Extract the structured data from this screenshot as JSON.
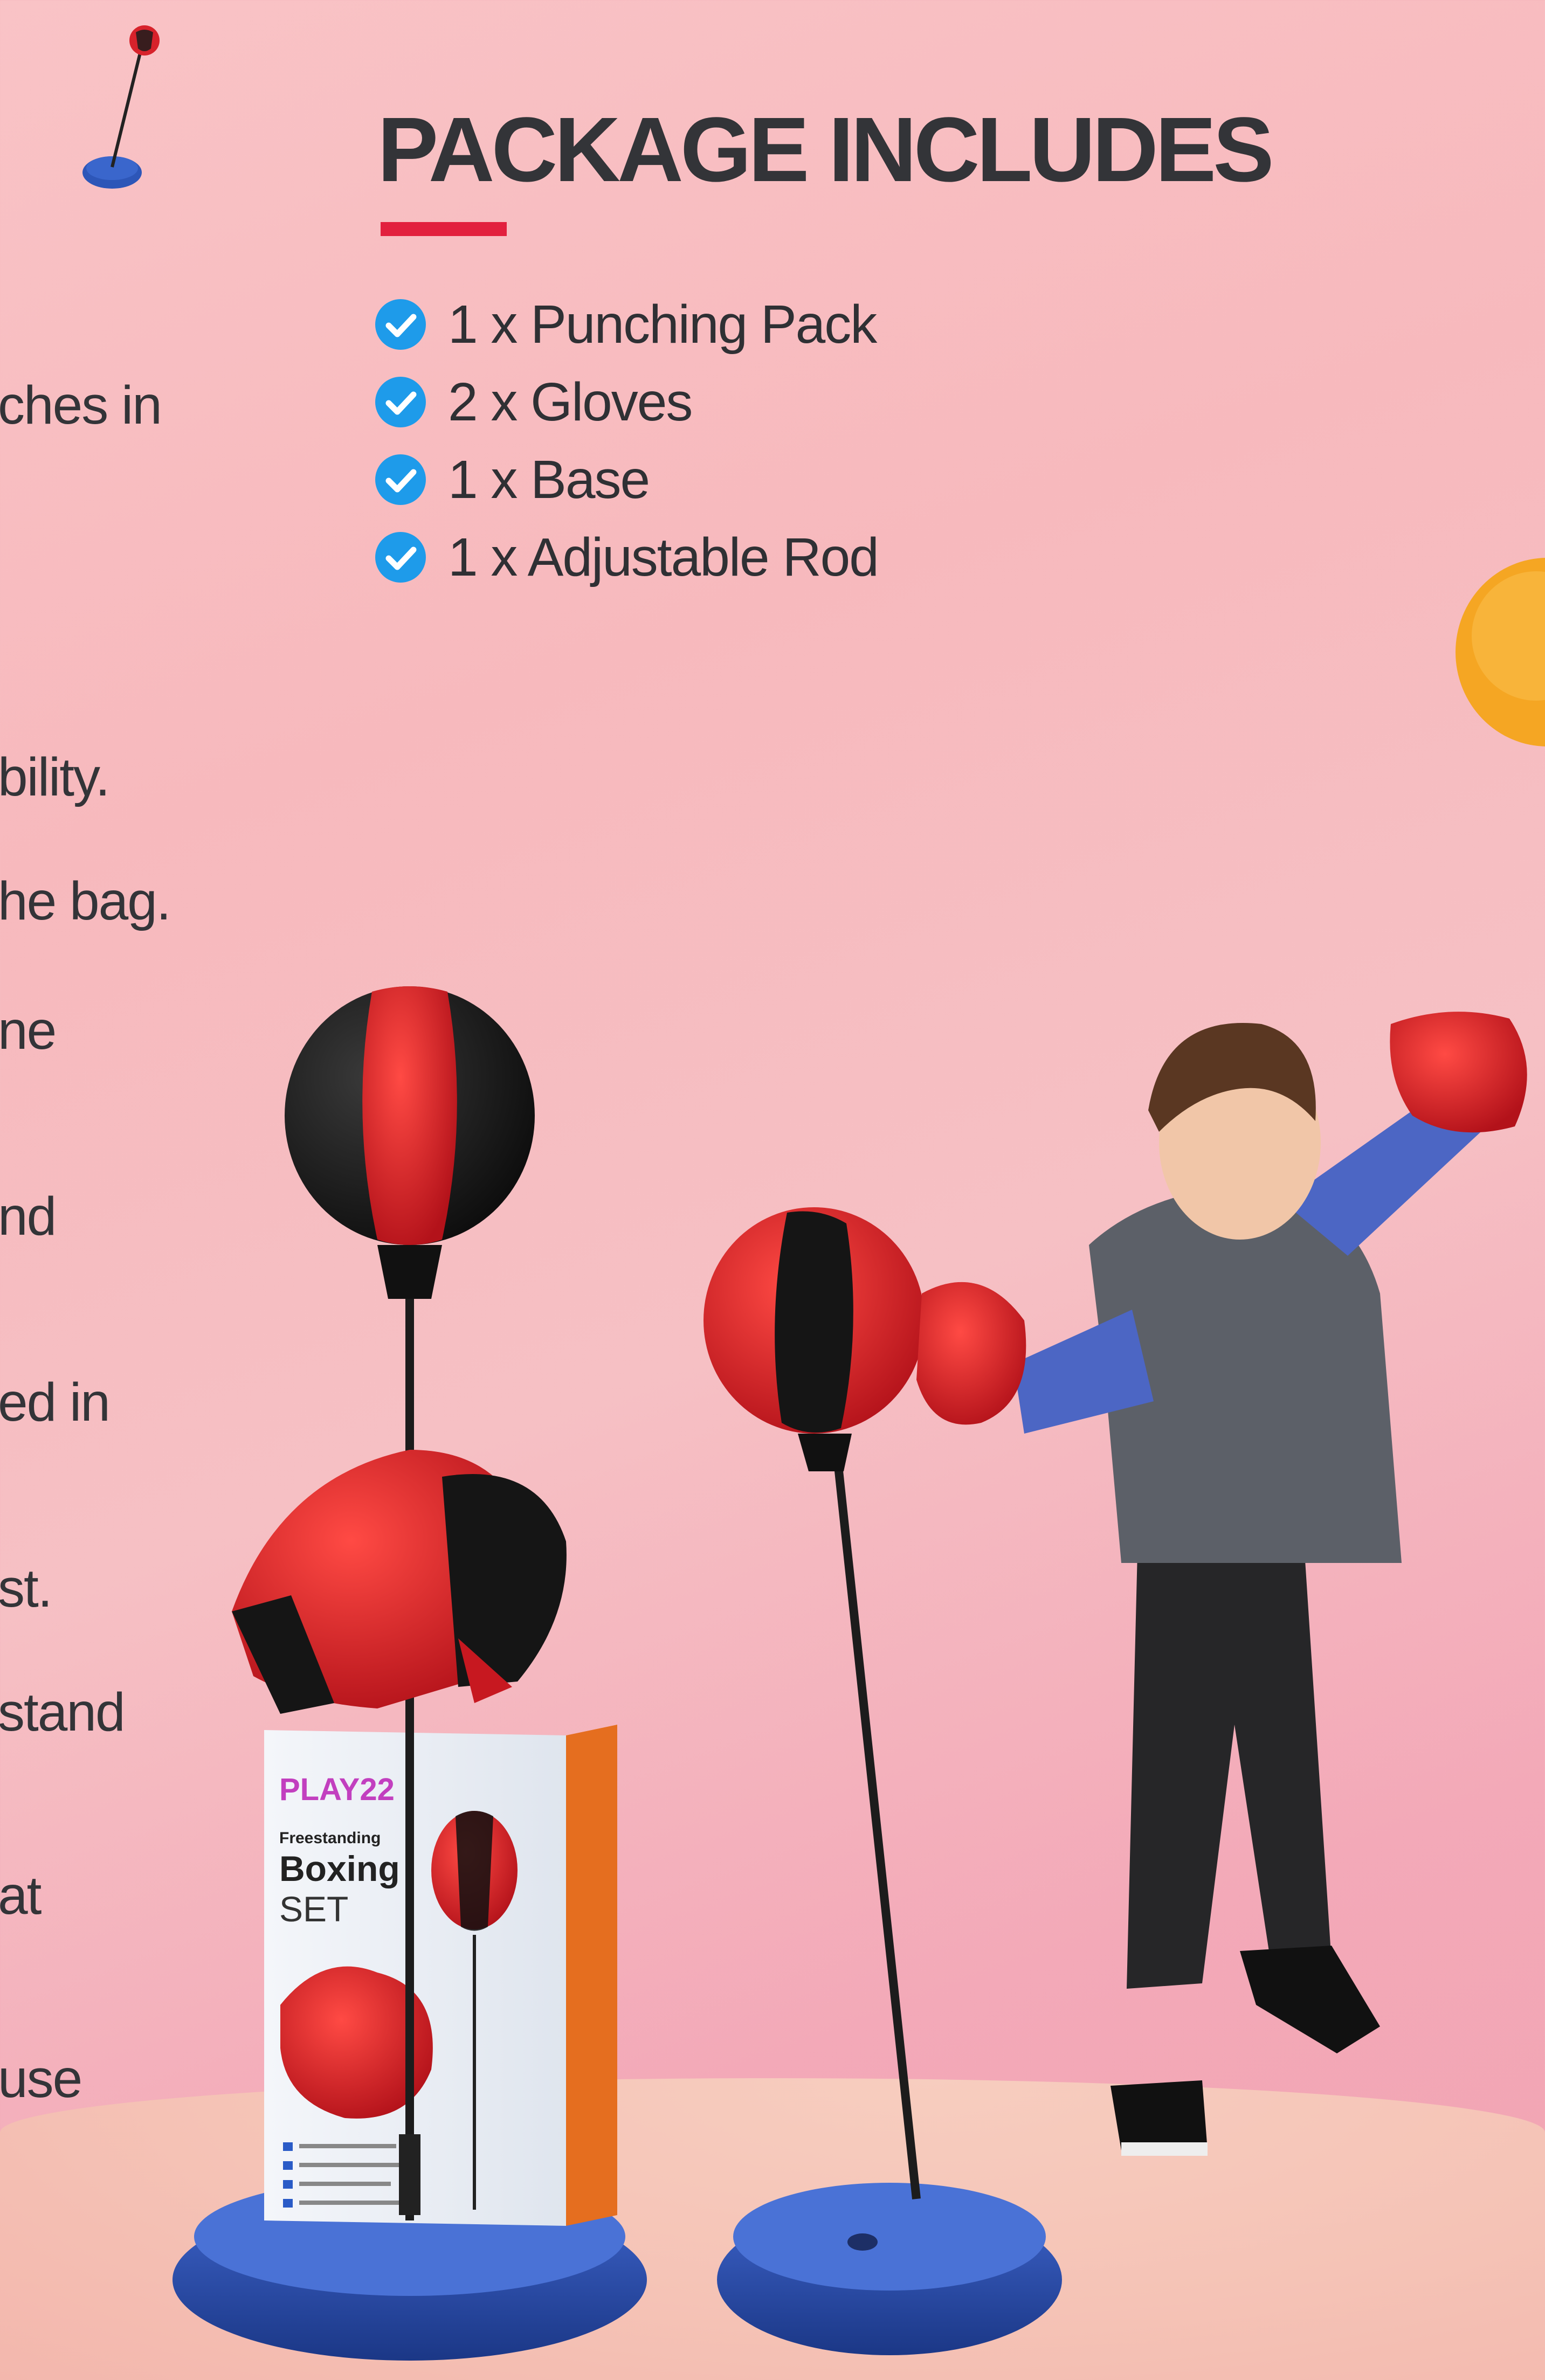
{
  "heading": "PACKAGE INCLUDES",
  "package_items": [
    "1 x Punching Pack",
    "2 x Gloves",
    "1 x Base",
    "1 x Adjustable Rod"
  ],
  "left_fragments": [
    "ches in",
    "bility.",
    "he bag.",
    "ne",
    "nd",
    "ed in",
    "st.",
    "stand",
    "at",
    "use"
  ],
  "box": {
    "brand": "PLAY22",
    "line1": "Freestanding",
    "line2": "Boxing",
    "line3": "SET"
  },
  "colors": {
    "accent_red": "#e2203e",
    "check_blue": "#1e9bea",
    "heading_dark": "#333438"
  },
  "icons": [
    "check-circle-icon"
  ]
}
